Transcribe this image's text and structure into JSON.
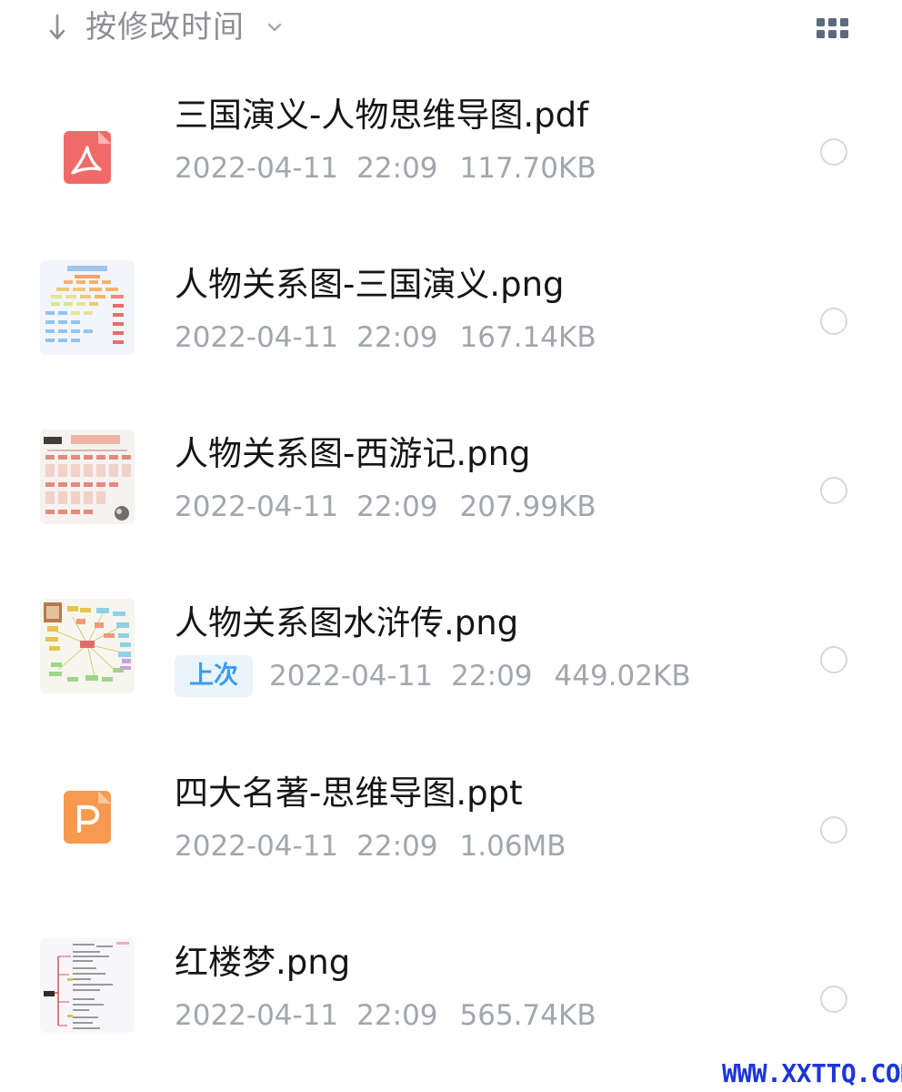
{
  "header": {
    "sort_label": "按修改时间",
    "sort_icon": "down-arrow-icon",
    "chevron_icon": "chevron-down-icon",
    "view_toggle_icon": "grid-view-icon"
  },
  "files": [
    {
      "name": "三国演义-人物思维导图.pdf",
      "date": "2022-04-11",
      "time": "22:09",
      "size": "117.70KB",
      "type": "pdf",
      "badge": ""
    },
    {
      "name": "人物关系图-三国演义.png",
      "date": "2022-04-11",
      "time": "22:09",
      "size": "167.14KB",
      "type": "png",
      "badge": ""
    },
    {
      "name": "人物关系图-西游记.png",
      "date": "2022-04-11",
      "time": "22:09",
      "size": "207.99KB",
      "type": "png",
      "badge": ""
    },
    {
      "name": "人物关系图水浒传.png",
      "date": "2022-04-11",
      "time": "22:09",
      "size": "449.02KB",
      "type": "png",
      "badge": "上次"
    },
    {
      "name": "四大名著-思维导图.ppt",
      "date": "2022-04-11",
      "time": "22:09",
      "size": "1.06MB",
      "type": "ppt",
      "badge": ""
    },
    {
      "name": "红楼梦.png",
      "date": "2022-04-11",
      "time": "22:09",
      "size": "565.74KB",
      "type": "png",
      "badge": ""
    }
  ],
  "colors": {
    "pdf_icon": "#f06a6a",
    "ppt_icon": "#f79a4f",
    "badge_text": "#3c9bf0",
    "badge_bg": "#eaf4fd",
    "meta_text": "#a2a6ad",
    "watermark": "#1d36d7"
  },
  "watermark": "WWW.XXTTQ.COM"
}
